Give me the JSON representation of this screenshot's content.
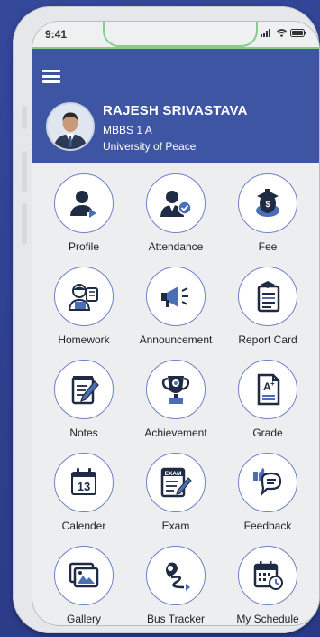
{
  "status": {
    "time": "9:41"
  },
  "profile": {
    "name": "RAJESH SRIVASTAVA",
    "course": "MBBS 1 A",
    "university": "University of Peace"
  },
  "menu": [
    {
      "label": "Profile",
      "icon": "profile-icon"
    },
    {
      "label": "Attendance",
      "icon": "attendance-icon"
    },
    {
      "label": "Fee",
      "icon": "fee-icon"
    },
    {
      "label": "Homework",
      "icon": "homework-icon"
    },
    {
      "label": "Announcement",
      "icon": "megaphone-icon"
    },
    {
      "label": "Report Card",
      "icon": "report-card-icon"
    },
    {
      "label": "Notes",
      "icon": "notes-icon"
    },
    {
      "label": "Achievement",
      "icon": "trophy-icon"
    },
    {
      "label": "Grade",
      "icon": "grade-icon"
    },
    {
      "label": "Calender",
      "icon": "calendar-icon",
      "badge": "13"
    },
    {
      "label": "Exam",
      "icon": "exam-icon",
      "badge": "EXAM"
    },
    {
      "label": "Feedback",
      "icon": "feedback-icon"
    },
    {
      "label": "Gallery",
      "icon": "gallery-icon"
    },
    {
      "label": "Bus Tracker",
      "icon": "bus-tracker-icon"
    },
    {
      "label": "My Schedule",
      "icon": "schedule-icon"
    }
  ],
  "colors": {
    "primary": "#3e55a3",
    "background": "#2e3f8c",
    "icon_dark": "#1f2a44",
    "icon_blue": "#4a6fb5"
  }
}
